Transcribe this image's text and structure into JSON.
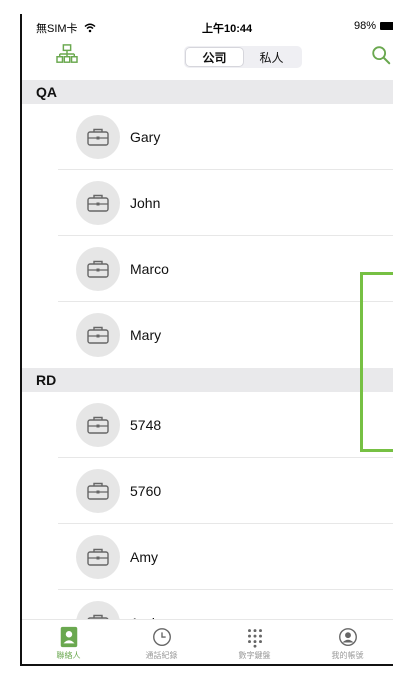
{
  "status_bar": {
    "carrier": "無SIM卡",
    "time": "上午10:44",
    "battery": "98%"
  },
  "header": {
    "segments": [
      {
        "label": "公司",
        "active": true
      },
      {
        "label": "私人",
        "active": false
      }
    ]
  },
  "sections": [
    {
      "title": "QA",
      "contacts": [
        "Gary",
        "John",
        "Marco",
        "Mary"
      ]
    },
    {
      "title": "RD",
      "contacts": [
        "5748",
        "5760",
        "Amy",
        "Andy"
      ]
    }
  ],
  "tabs": [
    {
      "label": "聯絡人",
      "icon": "contacts-icon",
      "active": true
    },
    {
      "label": "通話紀錄",
      "icon": "clock-icon",
      "active": false
    },
    {
      "label": "數字鍵盤",
      "icon": "keypad-icon",
      "active": false
    },
    {
      "label": "我的帳號",
      "icon": "account-icon",
      "active": false
    }
  ],
  "colors": {
    "accent": "#6aa84f",
    "overlay": "#76c043"
  }
}
